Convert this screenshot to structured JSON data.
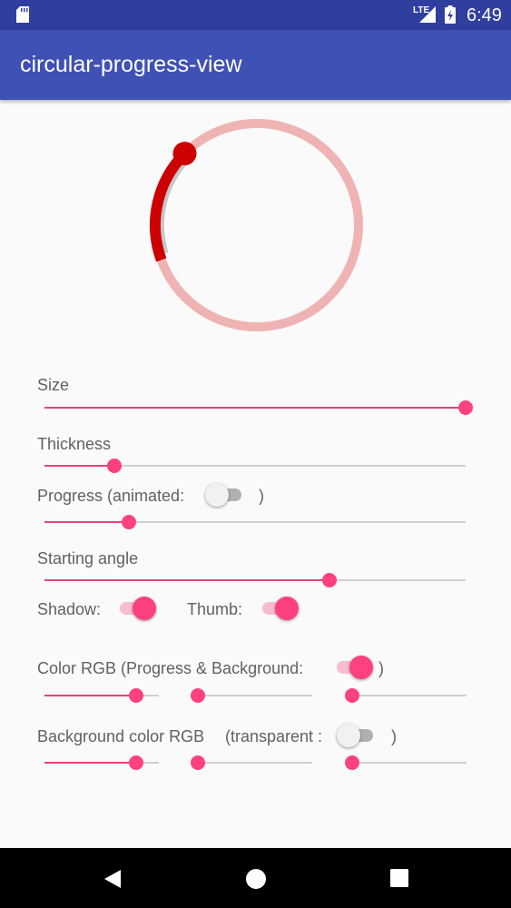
{
  "status_bar": {
    "network": "LTE",
    "time": "6:49"
  },
  "app_bar": {
    "title": "circular-progress-view"
  },
  "progress_view": {
    "progress": 0.18,
    "start_angle_deg": -110,
    "colors": {
      "progress": "#cc0000",
      "background": "#efb3b3",
      "shadow": "#c6c6c6"
    }
  },
  "controls": {
    "size": {
      "label": "Size",
      "value": 1.0
    },
    "thickness": {
      "label": "Thickness",
      "value": 0.167
    },
    "progress": {
      "label_before": "Progress (animated:",
      "label_after": ")",
      "value": 0.2,
      "animated": false
    },
    "starting_angle": {
      "label": "Starting angle",
      "value": 0.677
    },
    "shadow": {
      "label": "Shadow:",
      "on": true
    },
    "thumb": {
      "label": "Thumb:",
      "on": true
    },
    "color_rgb": {
      "label_before": "Color RGB (Progress & Background:",
      "label_after": ")",
      "on": true,
      "r": 0.8,
      "g": 0.0,
      "b": 0.0
    },
    "background_color_rgb": {
      "label_before": "Background color RGB",
      "label_mid": "(transparent :",
      "label_after": ")",
      "on": false,
      "r": 0.8,
      "g": 0.0,
      "b": 0.0
    }
  },
  "colors": {
    "status_bar": "#303f9f",
    "app_bar": "#3f51b5",
    "accent": "#ff4081",
    "nav_bar": "#000000"
  },
  "icons": {
    "status": [
      "sd-card-icon",
      "signal-icon",
      "battery-charging-icon"
    ],
    "nav": [
      "back-icon",
      "home-icon",
      "recents-icon"
    ]
  }
}
